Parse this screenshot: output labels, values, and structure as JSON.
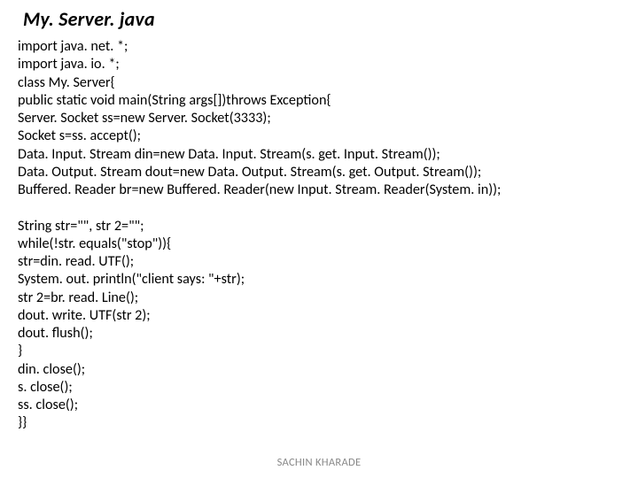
{
  "title": "My. Server. java",
  "code_lines": [
    "import java. net. *;",
    "import java. io. *;",
    "class My. Server{",
    "public static void main(String args[])throws Exception{",
    "Server. Socket ss=new Server. Socket(3333);",
    "Socket s=ss. accept();",
    "Data. Input. Stream din=new Data. Input. Stream(s. get. Input. Stream());",
    "Data. Output. Stream dout=new Data. Output. Stream(s. get. Output. Stream());",
    "Buffered. Reader br=new Buffered. Reader(new Input. Stream. Reader(System. in));",
    "",
    "String str=\"\", str 2=\"\";",
    "while(!str. equals(\"stop\")){",
    "str=din. read. UTF();",
    "System. out. println(\"client says: \"+str);",
    "str 2=br. read. Line();",
    "dout. write. UTF(str 2);",
    "dout. flush();",
    "}",
    "din. close();",
    "s. close();",
    "ss. close();",
    "}}"
  ],
  "footer": "SACHIN KHARADE"
}
